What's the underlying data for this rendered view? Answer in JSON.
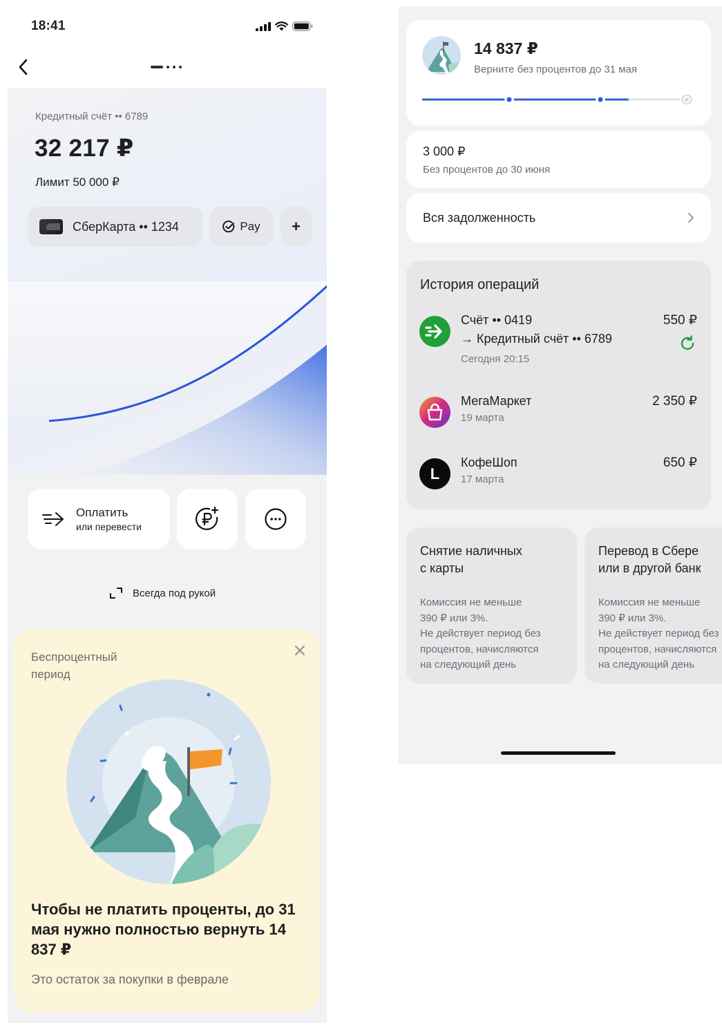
{
  "status_bar": {
    "time": "18:41"
  },
  "account": {
    "label": "Кредитный счёт •• 6789",
    "balance": "32 217 ₽",
    "limit": "Лимит 50 000 ₽"
  },
  "chips": {
    "card_label": "СберКарта •• 1234",
    "pay_label": "Pay",
    "add_symbol": "+"
  },
  "actions": {
    "pay_title": "Оплатить",
    "pay_subtitle": "или перевести"
  },
  "always_at_hand": "Всегда под рукой",
  "promo": {
    "title": "Беспроцентный период",
    "headline": "Чтобы не платить проценты, до 31 мая нужно полностью вернуть 14 837 ₽",
    "subtitle": "Это остаток за покупки в феврале"
  },
  "grace": {
    "amount": "14 837 ₽",
    "subtitle": "Верните без процентов до 31 мая",
    "progress_segments_filled": 2.6,
    "progress_segments_total": 3
  },
  "next_payment": {
    "amount": "3 000 ₽",
    "subtitle": "Без процентов до 30 июня"
  },
  "debt_link": "Вся задолженность",
  "history": {
    "title": "История операций",
    "operations": [
      {
        "name_line1": "Счёт •• 0419",
        "name_line2": "→ Кредитный счёт •• 6789",
        "date": "Сегодня 20:15",
        "amount": "550 ₽",
        "icon": "transfer-arrow-icon"
      },
      {
        "name_line1": "МегаМаркет",
        "date": "19 марта",
        "amount": "2 350 ₽",
        "icon": "shopping-bag-icon"
      },
      {
        "name_line1": "КофеШоп",
        "date": "17 марта",
        "amount": "650 ₽",
        "icon": "letter-l-icon",
        "icon_letter": "L"
      }
    ]
  },
  "info_cards": [
    {
      "title_line1": "Снятие наличных",
      "title_line2": "с карты",
      "text_lines": [
        "Комиссия не меньше",
        "390 ₽ или 3%.",
        "Не действует период без",
        "процентов, начисляются",
        "на следующий день"
      ]
    },
    {
      "title_line1": "Перевод в Сбере",
      "title_line2": "или в другой банк",
      "text_lines": [
        "Комиссия не меньше",
        "390 ₽ или 3%.",
        "Не действует период без",
        "процентов, начисляются",
        "на следующий день"
      ]
    }
  ],
  "colors": {
    "accent_blue": "#2e5fd1",
    "success_green": "#21a038",
    "promo_bg": "#fdf5d9",
    "screen_bg": "#f2f2f3"
  }
}
